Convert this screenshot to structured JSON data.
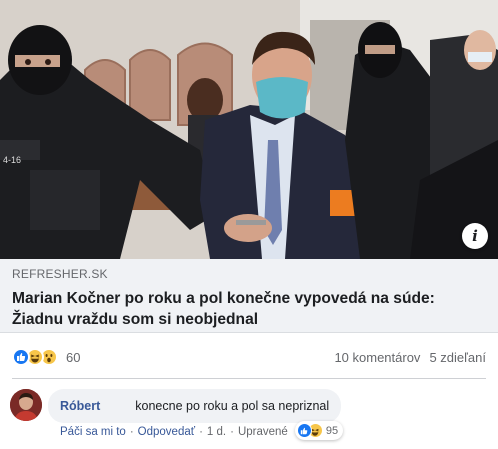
{
  "post": {
    "image_alt": "Marian Kočner escorted by masked police officers in a courtroom",
    "info_icon": "info-icon",
    "link": {
      "domain": "REFRESHER.SK",
      "headline": "Marian Kočner po roku a pol konečne vypovedá na súde: Žiadnu vraždu som si neobjednal"
    },
    "reactions": {
      "icons": [
        "like-icon",
        "haha-icon",
        "wow-icon"
      ],
      "count": "60",
      "comments": "10 komentárov",
      "shares": "5 zdieľaní"
    },
    "comment": {
      "author": "Róbert",
      "text": "konecne po roku a pol sa nepriznal",
      "like_label": "Páči sa mi to",
      "reply_label": "Odpovedať",
      "time": "1 d.",
      "edited": "Upravené",
      "sep": "·",
      "reaction_count": "95",
      "reaction_icons": [
        "like-icon",
        "haha-icon"
      ]
    }
  },
  "colors": {
    "link_blue": "#385898",
    "like_blue": "#1877f2",
    "haha_yellow": "#f7c64a",
    "muted": "#65676b",
    "preview_bg": "#f0f2f5"
  }
}
